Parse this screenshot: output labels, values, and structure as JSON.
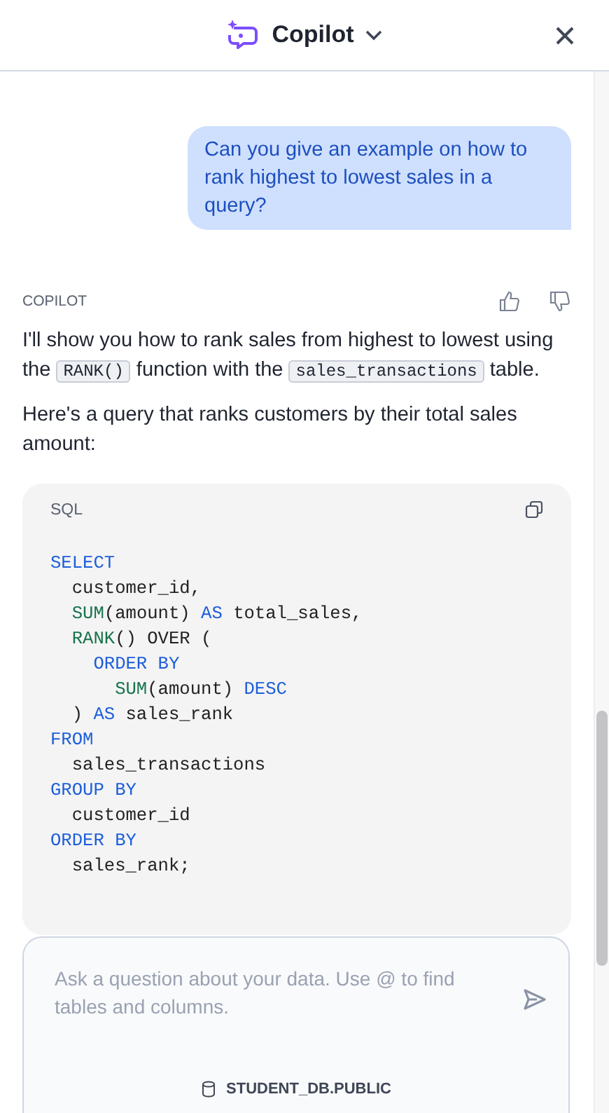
{
  "header": {
    "title": "Copilot"
  },
  "user_message": "Can you give an example on how to rank highest to lowest sales in a query?",
  "assistant": {
    "label": "COPILOT",
    "paragraphs": [
      [
        {
          "kind": "text",
          "text": "I'll show you how to rank sales from highest to lowest using the "
        },
        {
          "kind": "code",
          "text": "RANK()"
        },
        {
          "kind": "text",
          "text": " function with the "
        },
        {
          "kind": "code",
          "text": "sales_transactions"
        },
        {
          "kind": "text",
          "text": " table."
        }
      ],
      [
        {
          "kind": "text",
          "text": "Here's a query that ranks customers by their total sales amount:"
        }
      ]
    ],
    "code_block": {
      "language": "SQL",
      "lines": [
        [
          {
            "kind": "keyword",
            "text": "SELECT"
          }
        ],
        [
          {
            "kind": "plain",
            "text": "  customer_id,"
          }
        ],
        [
          {
            "kind": "function",
            "text": "  SUM"
          },
          {
            "kind": "plain",
            "text": "(amount) "
          },
          {
            "kind": "keyword",
            "text": "AS"
          },
          {
            "kind": "plain",
            "text": " total_sales,"
          }
        ],
        [
          {
            "kind": "function",
            "text": "  RANK"
          },
          {
            "kind": "plain",
            "text": "() OVER ("
          }
        ],
        [
          {
            "kind": "keyword",
            "text": "    ORDER BY"
          }
        ],
        [
          {
            "kind": "function",
            "text": "      SUM"
          },
          {
            "kind": "plain",
            "text": "(amount) "
          },
          {
            "kind": "keyword",
            "text": "DESC"
          }
        ],
        [
          {
            "kind": "plain",
            "text": "  ) "
          },
          {
            "kind": "keyword",
            "text": "AS"
          },
          {
            "kind": "plain",
            "text": " sales_rank"
          }
        ],
        [
          {
            "kind": "keyword",
            "text": "FROM"
          }
        ],
        [
          {
            "kind": "plain",
            "text": "  sales_transactions"
          }
        ],
        [
          {
            "kind": "keyword",
            "text": "GROUP BY"
          }
        ],
        [
          {
            "kind": "plain",
            "text": "  customer_id"
          }
        ],
        [
          {
            "kind": "keyword",
            "text": "ORDER BY"
          }
        ],
        [
          {
            "kind": "plain",
            "text": "  sales_rank;"
          }
        ]
      ]
    }
  },
  "composer": {
    "placeholder": "Ask a question about your data. Use @ to find tables and columns.",
    "schema": "STUDENT_DB.PUBLIC"
  }
}
